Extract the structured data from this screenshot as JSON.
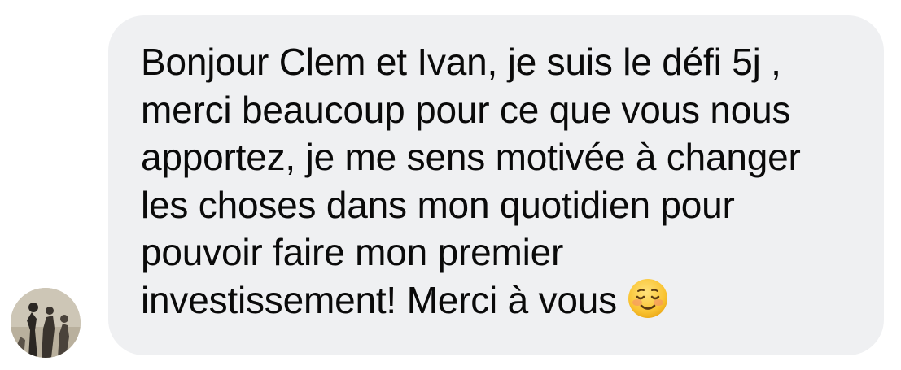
{
  "message": {
    "lines": [
      "Bonjour Clem et Ivan, je suis le défi 5j ,",
      "merci beaucoup pour ce que vous nous",
      "apportez, je me sens motivée à changer",
      "les choses dans mon quotidien pour",
      "pouvoir faire mon premier",
      "investissement! Merci à vous"
    ],
    "emoji": "smiling-face-emoji"
  },
  "sender": {
    "avatar": "profile-photo"
  },
  "colors": {
    "bubble": "#eff0f2",
    "text": "#0a0a0a",
    "emoji": "#f9c332"
  }
}
